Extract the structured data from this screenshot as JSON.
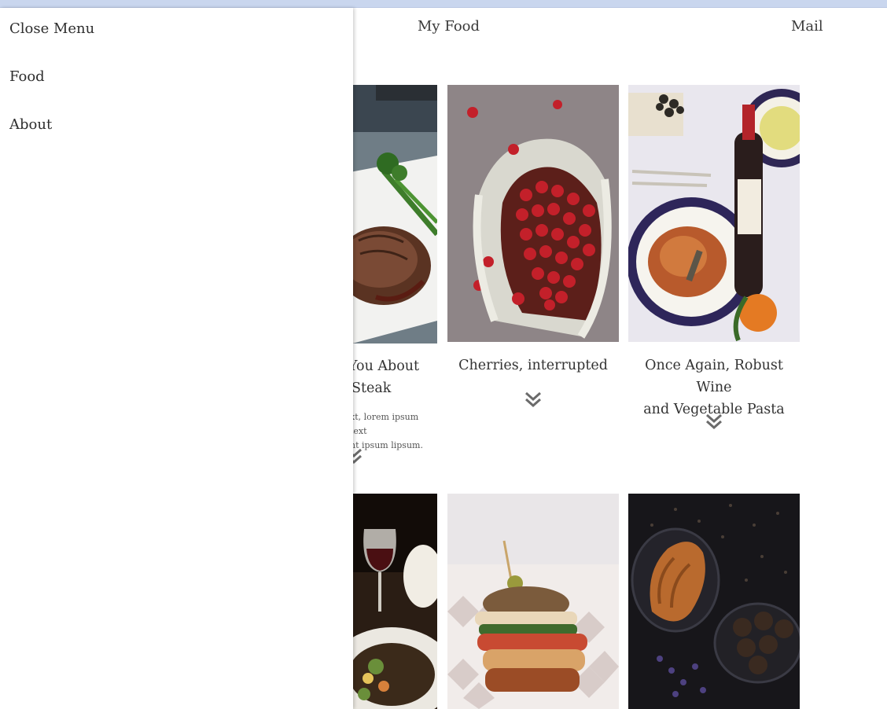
{
  "nav": {
    "my_food": "My Food",
    "mail": "Mail"
  },
  "side_menu": {
    "close": "Close Menu",
    "food": "Food",
    "about": "About"
  },
  "cards": [
    {
      "title_line1": "You About",
      "title_line2": "Steak",
      "text_line1": "xt, lorem ipsum text",
      "text_line2": "nt ipsum lipsum."
    },
    {
      "title": "Cherries, interrupted"
    },
    {
      "title_line1": "Once Again, Robust Wine",
      "title_line2": "and Vegetable Pasta"
    }
  ],
  "icons": {
    "expand": "double-chevron-down"
  },
  "colors": {
    "browser_strip": "#c9d6ee",
    "chevron": "#6b6b6b",
    "text": "#333333"
  }
}
